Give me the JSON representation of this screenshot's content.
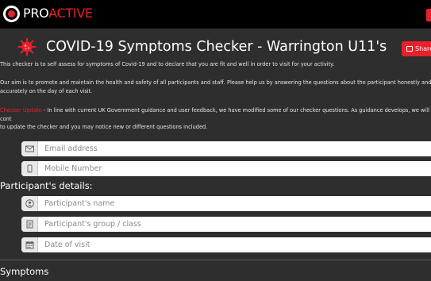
{
  "header": {
    "brand_pro": "PRO",
    "brand_active": "ACTIVE"
  },
  "page": {
    "title": "COVID-19 Symptoms Checker - Warrington U11's",
    "share_button": "Share t",
    "intro": "This checker is to self assess for symptoms of Covid-19 and to declare that you are fit and well in order to visit for your activity.",
    "aim_line1": "Our aim is to promote and maintain the health and safety of all participants and staff. Please help us by answering the questions about the participant honestly and",
    "aim_line2": "accurately on the day of each visit.",
    "update_label": "Checker Update",
    "update_line1": " - In line with current UK Government guidance and user feedback, we have modified some of our checker questions. As guidance develops, we will cont",
    "update_line2": "to update the checker and you may notice new or different questions included."
  },
  "form": {
    "email_placeholder": "Email address",
    "mobile_placeholder": "Mobile Number",
    "participant_heading": "Participant's details:",
    "name_placeholder": "Participant's name",
    "group_placeholder": "Participant's group / class",
    "date_placeholder": "Date of visit",
    "symptoms_heading": "Symptoms"
  },
  "colors": {
    "accent": "#e8202a",
    "background": "#2e2e2e",
    "topbar": "#000000"
  }
}
